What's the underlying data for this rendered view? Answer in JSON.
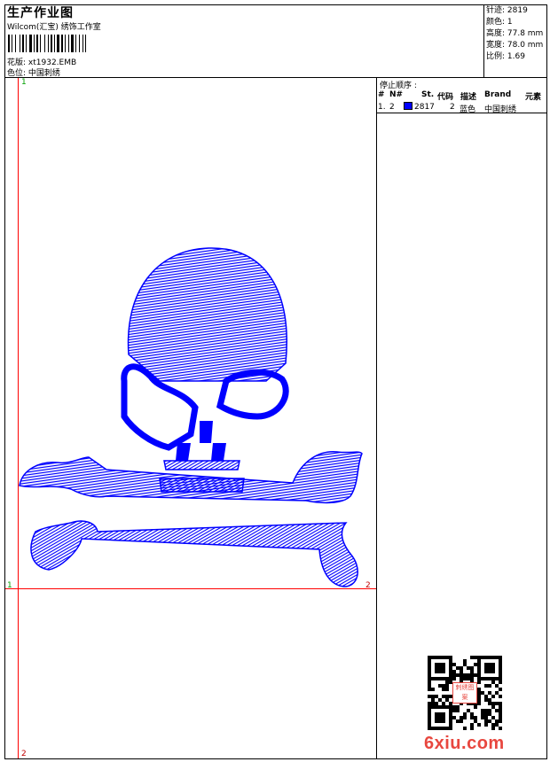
{
  "header": {
    "title": "生产作业图",
    "software": "Wilcom(汇宝) 绣饰工作室",
    "design_label": "花版:",
    "design_file": "xt1932.EMB",
    "color_label": "色位:",
    "color_value": "中国刺绣"
  },
  "stats": {
    "stitches": "针迹: 2819",
    "colors": "颜色: 1",
    "height": "高度: 77.8 mm",
    "width": "宽度: 78.0 mm",
    "scale": "比例: 1.69"
  },
  "stop_sequence": {
    "heading": "停止顺序 :",
    "columns": [
      "#",
      "N#",
      "St.",
      "代码",
      "描述",
      "Brand",
      "元素"
    ],
    "rows": [
      {
        "index": "1.",
        "needle": "2",
        "stitches": "2817",
        "code": "2",
        "description": "蓝色",
        "brand": "中国刺绣",
        "element": ""
      }
    ]
  },
  "design": {
    "thread_color": "#0000ff",
    "guide_color": "#ff0000",
    "markers": {
      "top_left": "1",
      "mid_left": "1",
      "mid_right": "2",
      "bottom_left": "2"
    }
  },
  "watermark": {
    "site": "6xiu.com",
    "qr_label": "刺绣图案"
  }
}
